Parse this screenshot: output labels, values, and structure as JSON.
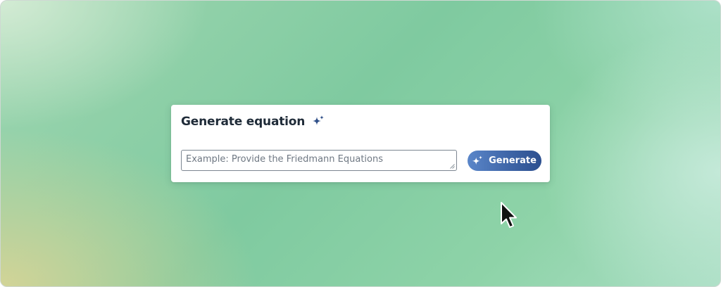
{
  "card": {
    "title": "Generate equation",
    "title_icon": "sparkles-icon"
  },
  "prompt": {
    "value": "",
    "placeholder": "Example: Provide the Friedmann Equations"
  },
  "generate_button": {
    "label": "Generate",
    "icon": "sparkles-icon"
  },
  "colors": {
    "accent": "#3f66a8",
    "title_text": "#1f2b38",
    "background_green": "#7fcaa0"
  }
}
